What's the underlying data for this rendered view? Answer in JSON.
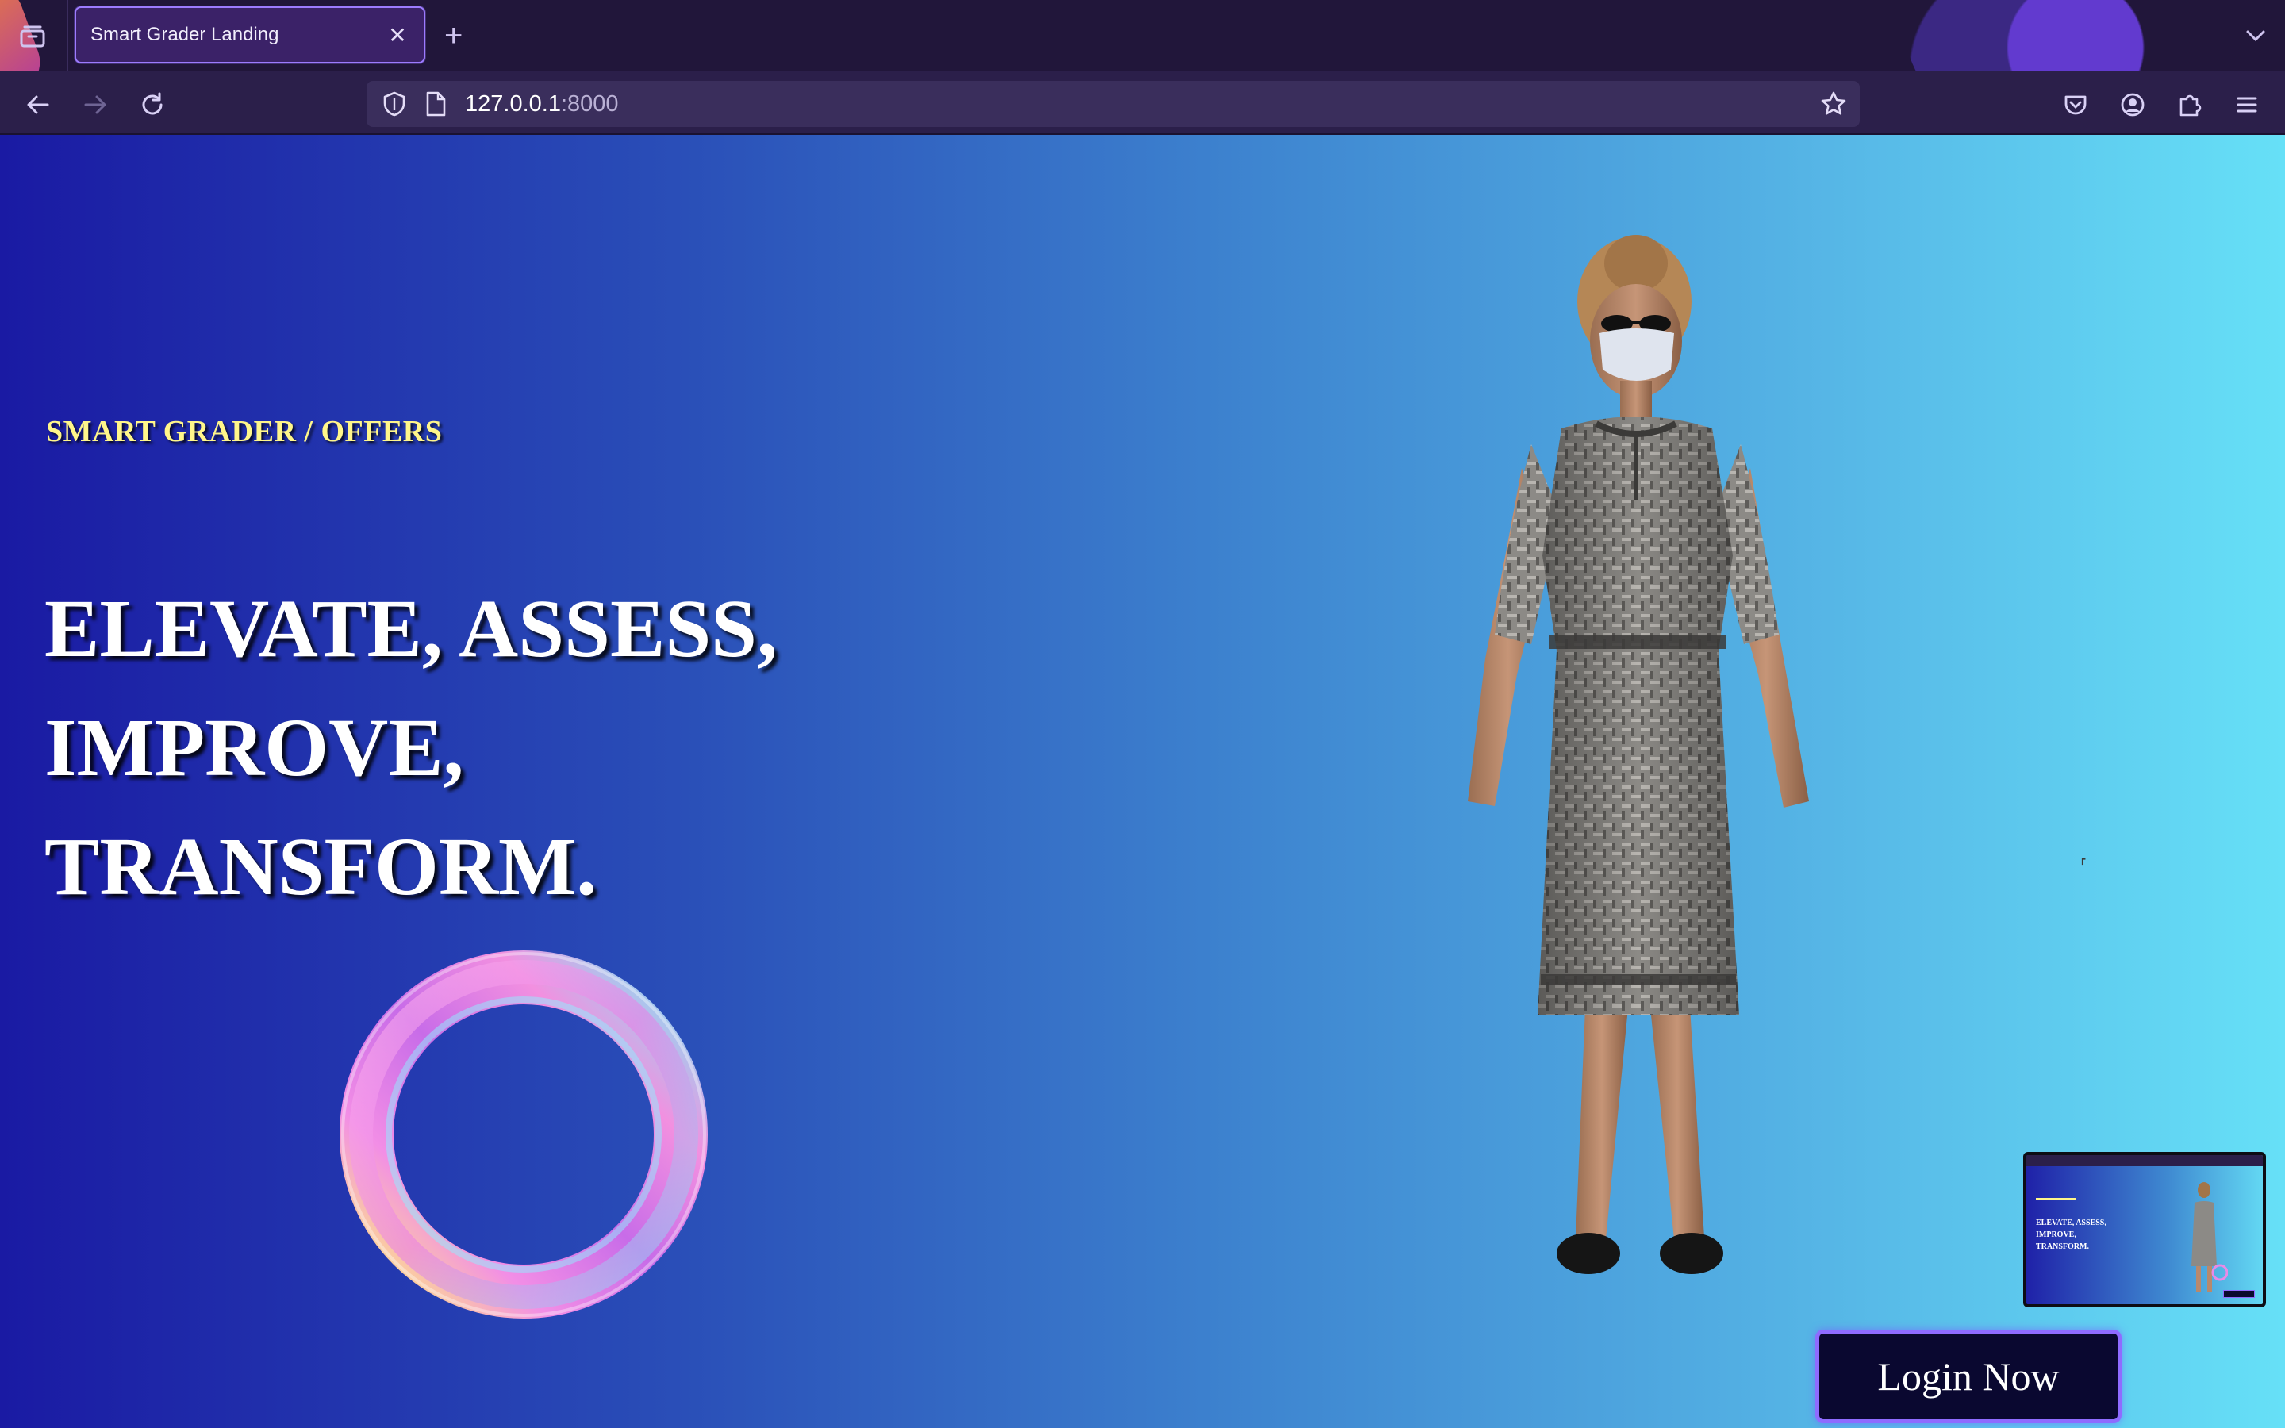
{
  "browser": {
    "tab": {
      "title": "Smart Grader Landing",
      "close_glyph": "✕"
    },
    "new_tab_glyph": "+",
    "url": {
      "host": "127.0.0.1",
      "port": ":8000"
    },
    "icons": {
      "tab_list": "tab-list-icon",
      "back": "back-arrow-icon",
      "forward": "forward-arrow-icon",
      "reload": "reload-icon",
      "shield": "tracking-protection-shield-icon",
      "page": "page-info-icon",
      "bookmark": "bookmark-star-icon",
      "pocket": "pocket-icon",
      "account": "account-icon",
      "extensions": "extensions-puzzle-icon",
      "menu": "hamburger-menu-icon",
      "overflow": "chevron-down-icon"
    },
    "colors": {
      "chrome": "#21163a",
      "toolbar": "#2b1f4a",
      "tab_border": "#9d7bff"
    }
  },
  "page": {
    "eyebrow": "SMART GRADER / OFFERS",
    "headline": [
      "ELEVATE, ASSESS,",
      "IMPROVE,",
      "TRANSFORM."
    ],
    "cursor_glyph": "⸢",
    "pip": {
      "lines": [
        "ELEVATE, ASSESS,",
        "IMPROVE,",
        "TRANSFORM."
      ]
    },
    "login_label": "Login Now",
    "colors": {
      "gradient_start": "#1a1aa3",
      "gradient_end": "#66e0f7",
      "eyebrow": "#fff68a",
      "button_bg": "#0a0830",
      "button_border": "#8f6bff"
    }
  }
}
